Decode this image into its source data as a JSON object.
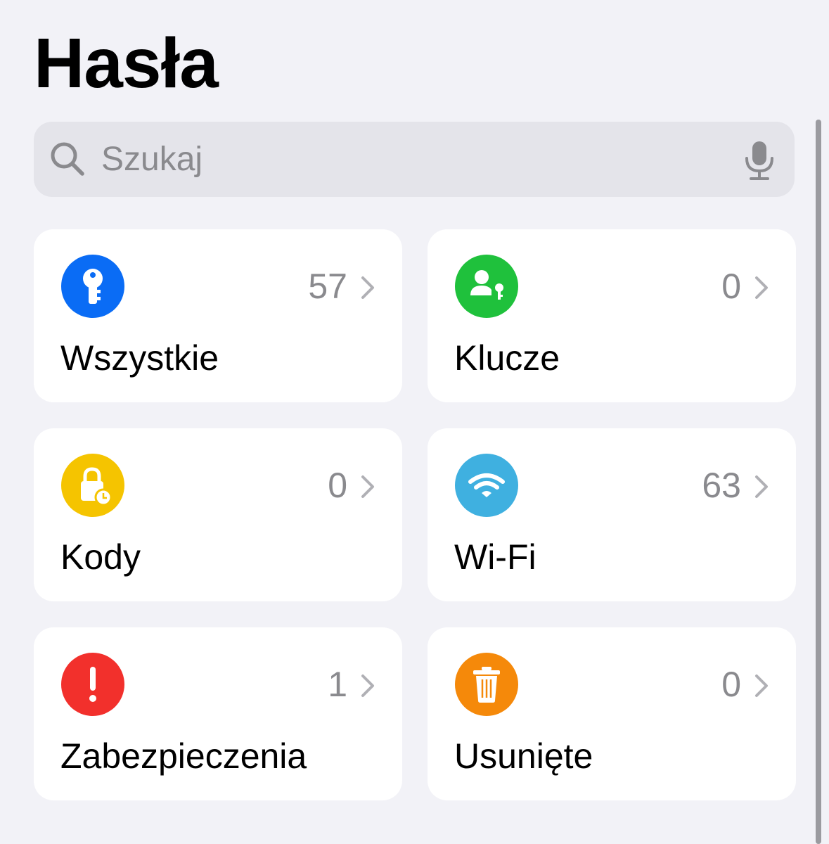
{
  "header": {
    "title": "Hasła"
  },
  "search": {
    "placeholder": "Szukaj",
    "icon": "magnifying-glass-icon",
    "mic_icon": "microphone-icon"
  },
  "categories": [
    {
      "label": "Wszystkie",
      "count": "57",
      "icon": "key-icon",
      "color": "#0a6cf5"
    },
    {
      "label": "Klucze",
      "count": "0",
      "icon": "person-key-icon",
      "color": "#1fc13c"
    },
    {
      "label": "Kody",
      "count": "0",
      "icon": "lock-clock-icon",
      "color": "#f5c400"
    },
    {
      "label": "Wi-Fi",
      "count": "63",
      "icon": "wifi-icon",
      "color": "#3fb0e0"
    },
    {
      "label": "Zabezpieczenia",
      "count": "1",
      "icon": "exclamation-icon",
      "color": "#f2302c"
    },
    {
      "label": "Usunięte",
      "count": "0",
      "icon": "trash-icon",
      "color": "#f5890a"
    }
  ]
}
